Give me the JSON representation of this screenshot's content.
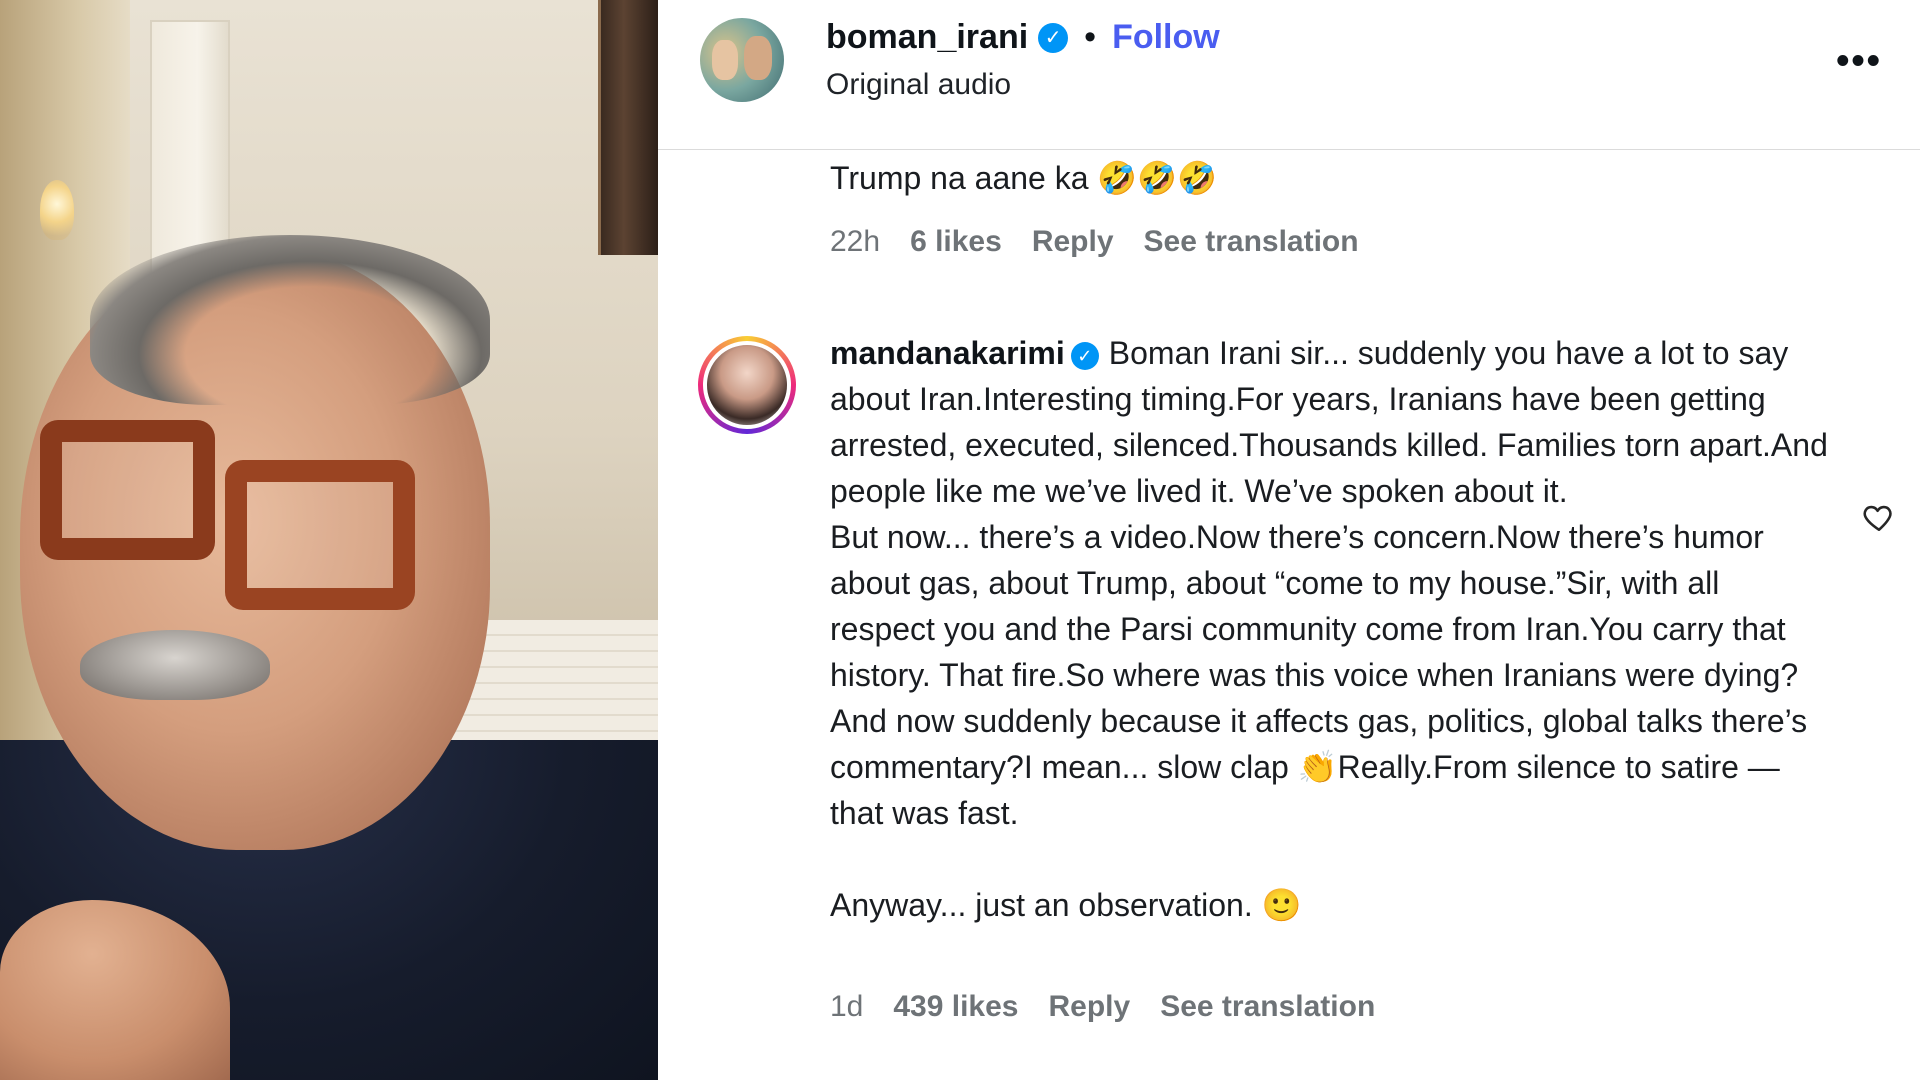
{
  "header": {
    "username": "boman_irani",
    "verified_glyph": "✓",
    "separator": "•",
    "follow_label": "Follow",
    "audio_label": "Original audio",
    "more_label": "•••"
  },
  "comments": [
    {
      "text": "Trump na aane ka 🤣🤣🤣",
      "time": "22h",
      "likes": "6 likes",
      "reply": "Reply",
      "translation": "See translation"
    },
    {
      "username": "mandanakarimi",
      "verified_glyph": "✓",
      "paragraph1": "Boman Irani sir... suddenly you have a lot to say about Iran.Interesting timing.For years, Iranians have been getting arrested, executed, silenced.Thousands killed. Families torn apart.And people like me we’ve lived it. We’ve spoken about it.",
      "paragraph2": "But now... there’s a video.Now there’s concern.Now there’s humor about gas, about Trump, about “come to my house.”Sir, with all respect you and the Parsi community come from Iran.You carry that history. That fire.So where was this voice when Iranians were dying?And now suddenly because it affects gas, politics, global talks there’s commentary?I mean... slow clap 👏Really.From silence to satire — that was fast.",
      "paragraph3": "Anyway... just an observation. 🙂",
      "time": "1d",
      "likes": "439 likes",
      "reply": "Reply",
      "translation": "See translation"
    }
  ],
  "icons": {
    "heart": "heart-outline-icon",
    "more": "more-options-icon",
    "verified": "verified-badge-icon"
  },
  "colors": {
    "follow": "#4a5df0",
    "verified": "#0095f6",
    "meta_text": "#6e7377"
  }
}
